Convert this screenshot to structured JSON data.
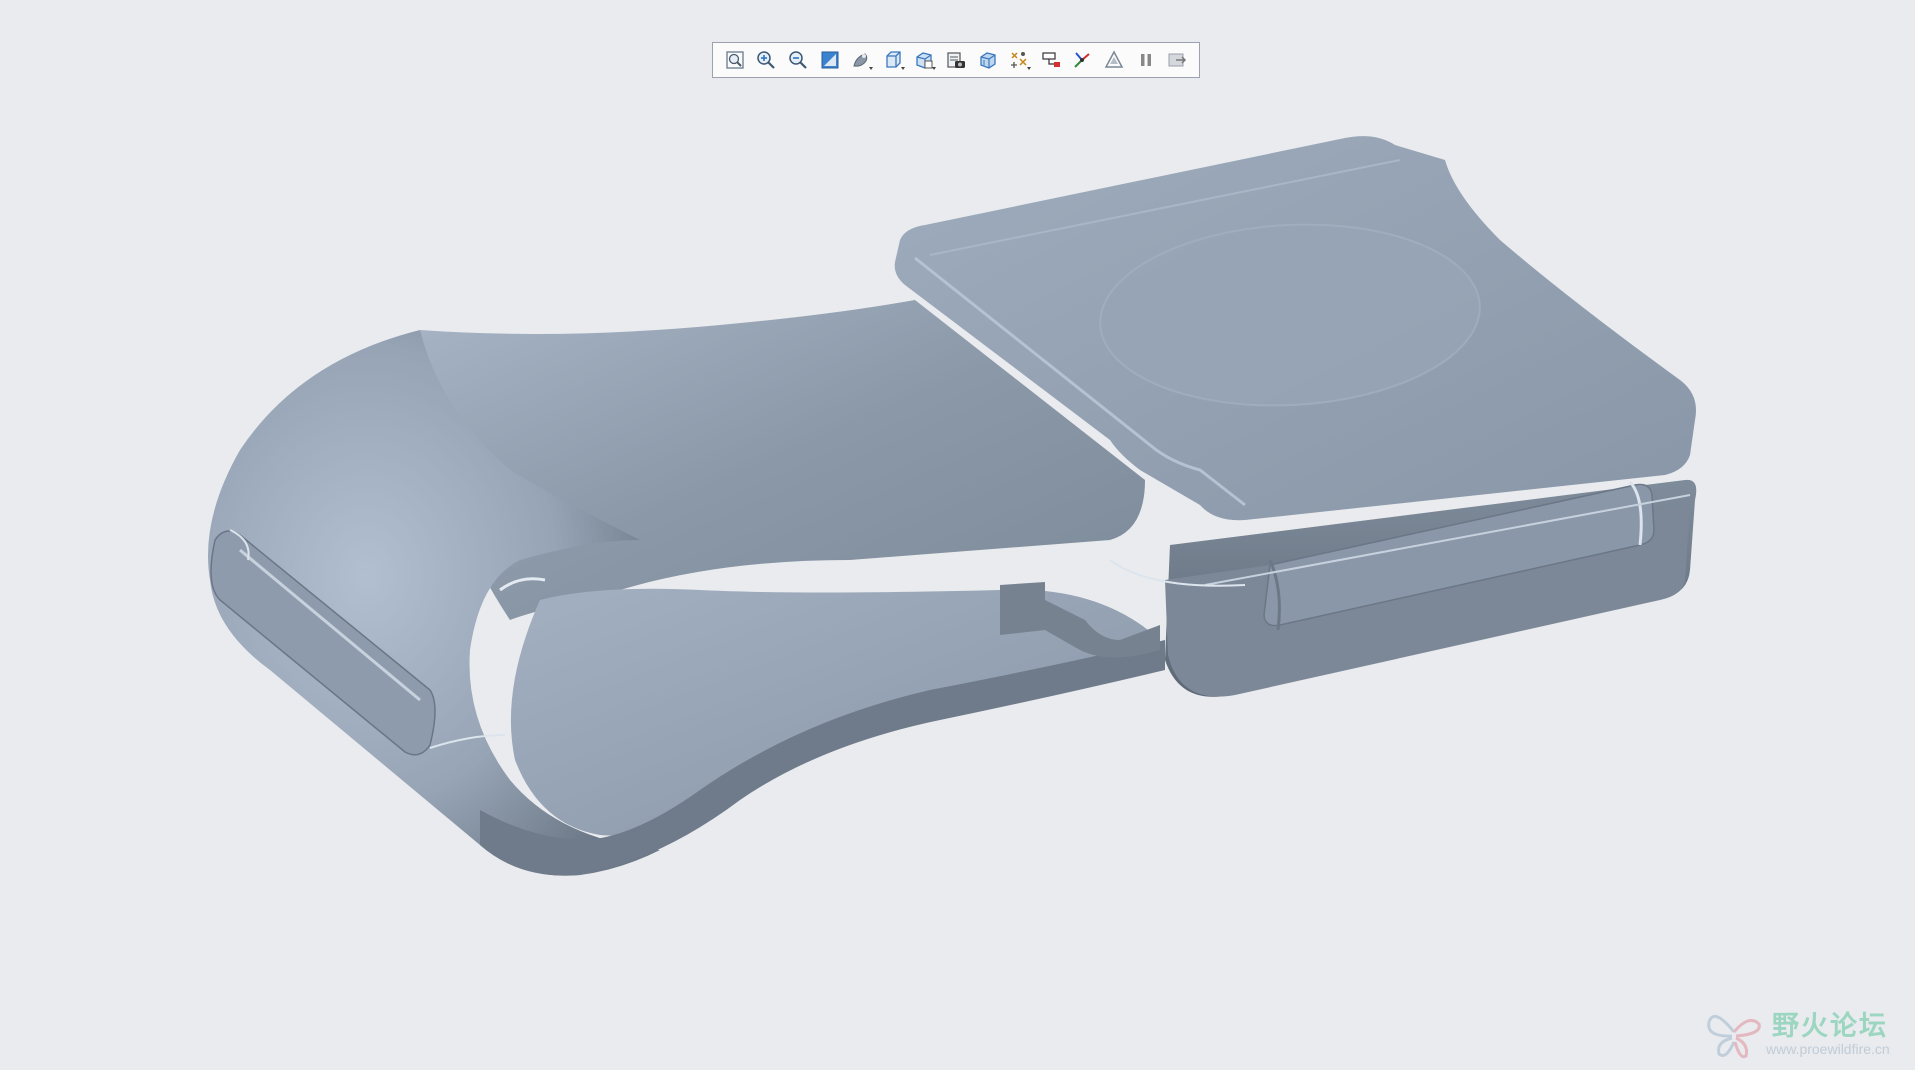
{
  "viewport": {
    "background": "#e9ebee",
    "model_color": "#8e9cad"
  },
  "toolbar": {
    "buttons": [
      {
        "name": "refit-icon",
        "tooltip": "Refit"
      },
      {
        "name": "zoom-in-icon",
        "tooltip": "Zoom In"
      },
      {
        "name": "zoom-out-icon",
        "tooltip": "Zoom Out"
      },
      {
        "name": "repaint-icon",
        "tooltip": "Repaint"
      },
      {
        "name": "display-style-icon",
        "tooltip": "Display Style"
      },
      {
        "name": "saved-orientations-icon",
        "tooltip": "Saved Orientations"
      },
      {
        "name": "view-manager-icon",
        "tooltip": "View Manager"
      },
      {
        "name": "perspective-view-icon",
        "tooltip": "Perspective View"
      },
      {
        "name": "section-view-icon",
        "tooltip": "Section"
      },
      {
        "name": "datum-display-icon",
        "tooltip": "Datum Display Filters"
      },
      {
        "name": "annotation-display-icon",
        "tooltip": "Annotation Display"
      },
      {
        "name": "spin-center-icon",
        "tooltip": "Spin Center"
      },
      {
        "name": "simulation-display-icon",
        "tooltip": "Simulation Display"
      },
      {
        "name": "pause-icon",
        "tooltip": "Pause"
      },
      {
        "name": "exit-icon",
        "tooltip": "Exit"
      }
    ]
  },
  "watermark": {
    "title": "野火论坛",
    "url": "www.proewildfire.cn",
    "title_color": "#8fd3b9",
    "url_color": "#b9c7d4"
  }
}
